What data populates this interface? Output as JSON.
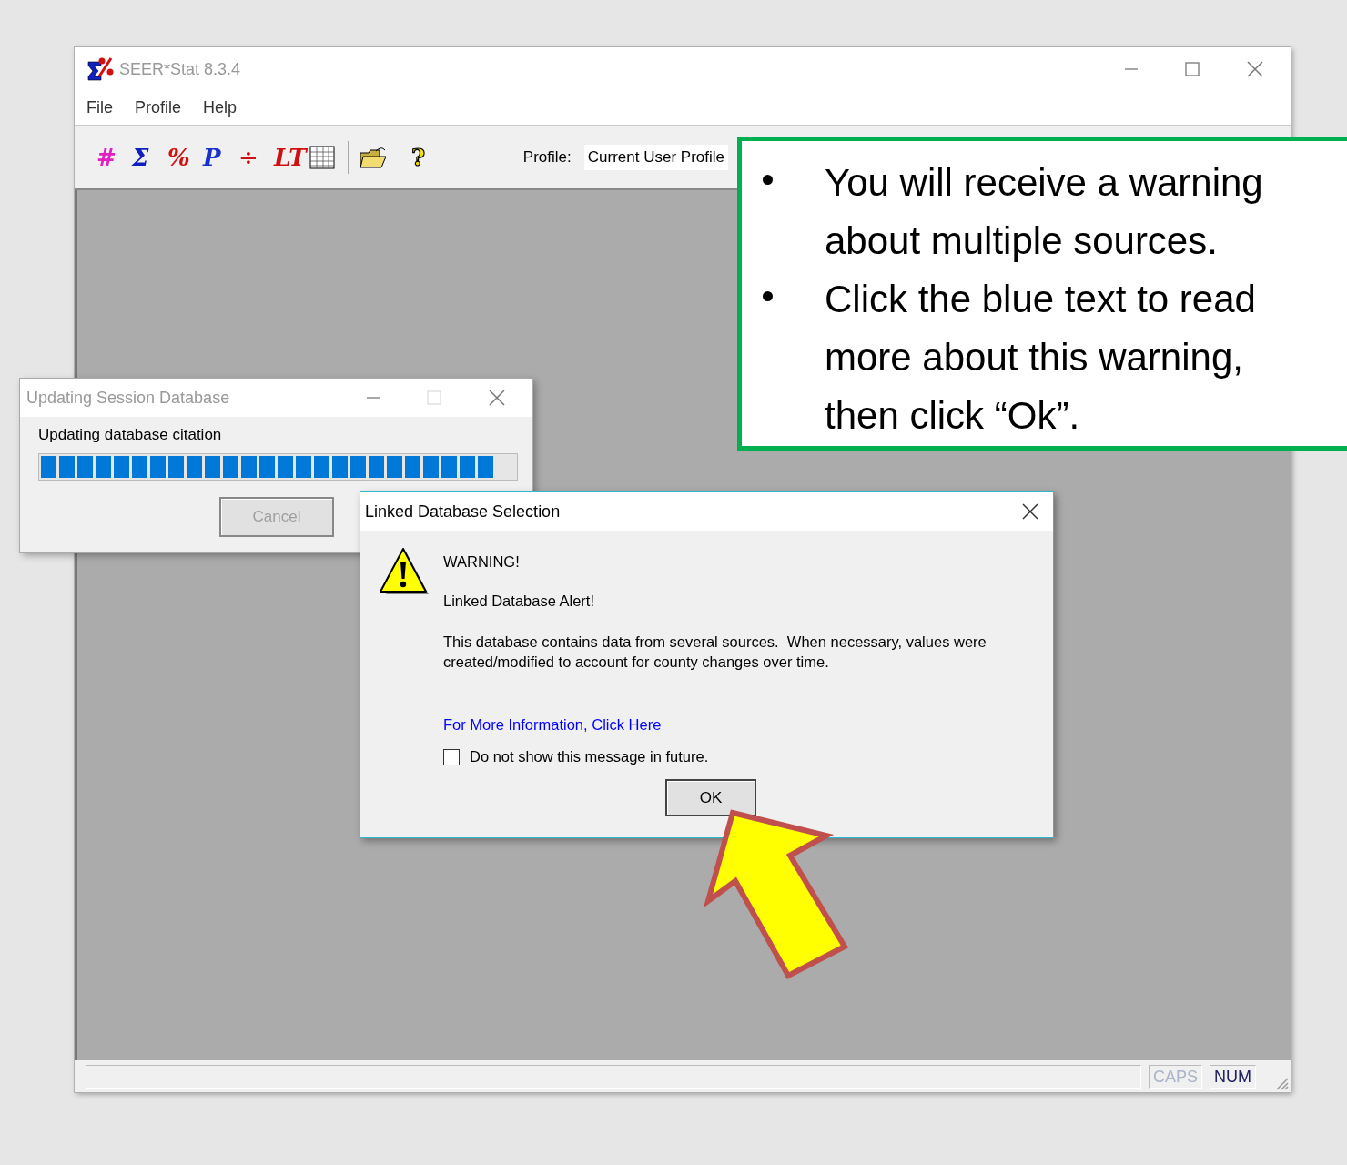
{
  "main_window": {
    "title": "SEER*Stat 8.3.4",
    "menu": [
      "File",
      "Profile",
      "Help"
    ],
    "toolbar": {
      "buttons": [
        {
          "kind": "glyph",
          "glyph": "#",
          "color": "#e020c0"
        },
        {
          "kind": "glyph",
          "glyph": "Σ",
          "color": "#1020c0"
        },
        {
          "kind": "glyph",
          "glyph": "%",
          "color": "#d01010"
        },
        {
          "kind": "glyph",
          "glyph": "P",
          "color": "#1830d0"
        },
        {
          "kind": "glyph",
          "glyph": "÷",
          "color": "#d01010"
        },
        {
          "kind": "glyph",
          "glyph": "LT",
          "color": "#d01010"
        },
        {
          "kind": "table"
        },
        {
          "kind": "separator"
        },
        {
          "kind": "folder"
        },
        {
          "kind": "separator"
        },
        {
          "kind": "outlined-glyph",
          "glyph": "?",
          "color": "#f0e000"
        }
      ],
      "profile_label": "Profile:",
      "profile_value": "Current User Profile"
    },
    "status_bar": [
      {
        "label": "CAPS",
        "on": false
      },
      {
        "label": "NUM",
        "on": true
      }
    ]
  },
  "progress_dialog": {
    "title": "Updating Session Database",
    "message": "Updating database citation",
    "progress": {
      "level": 0.96
    },
    "cancel_button": {
      "label": "Cancel",
      "disabled": true
    }
  },
  "alert_dialog": {
    "title": "Linked Database Selection",
    "heading": "WARNING!",
    "subheading": "Linked Database Alert!",
    "body": "This database contains data from several sources.  When necessary, values were created/modified to account for county changes over time.",
    "link": "For More Information, Click Here",
    "checkbox": {
      "label": "Do not show this message in future.",
      "checked": false
    },
    "ok_button": "OK"
  },
  "callout": {
    "bullets": [
      "You will receive a warning about multiple sources.",
      "Click the blue text to read more about this warning, then click “Ok”."
    ]
  }
}
